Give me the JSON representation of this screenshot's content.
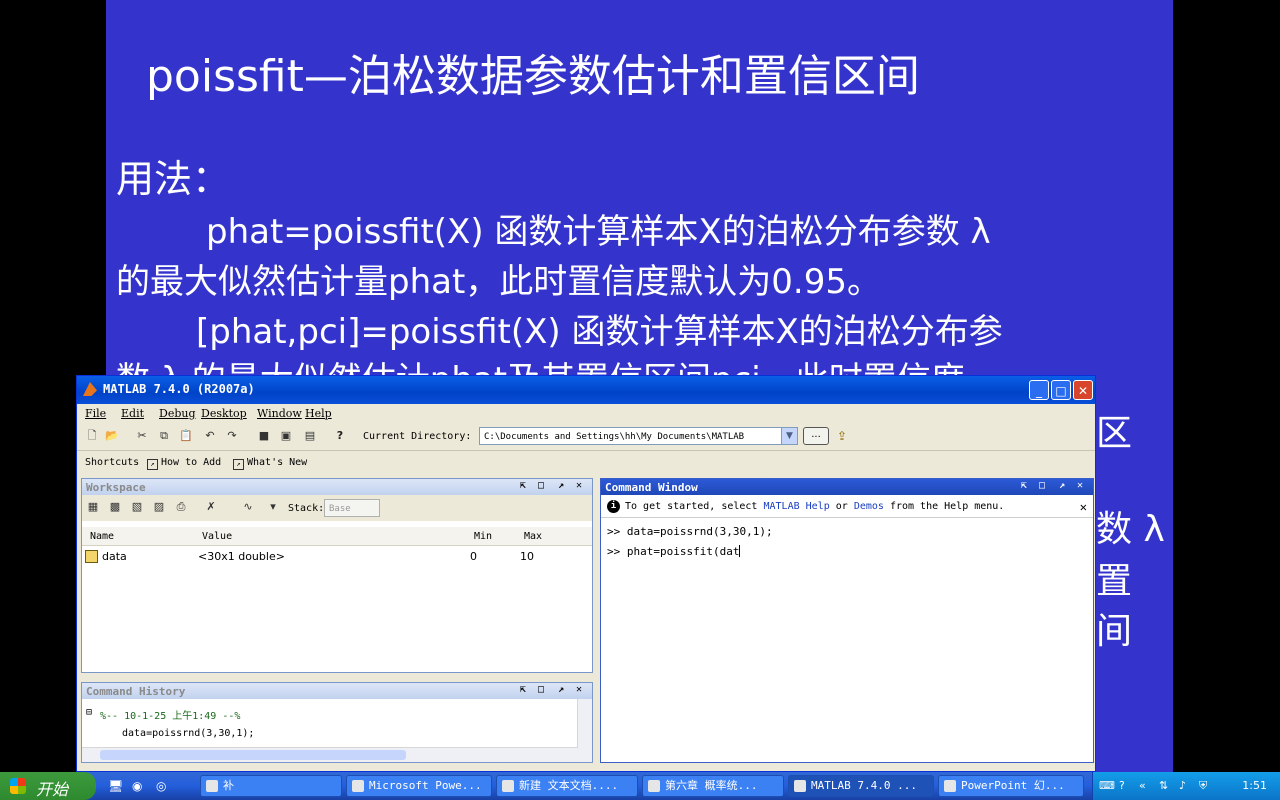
{
  "slide": {
    "title": "poissfit—泊松数据参数估计和置信区间",
    "usage": "用法：",
    "line1": "phat=poissfit(X)  函数计算样本X的泊松分布参数 λ",
    "line2": "的最大似然估计量phat，此时置信度默认为0.95。",
    "line3": "[phat,pci]=poissfit(X)  函数计算样本X的泊松分布参",
    "line4": "数 λ 的最大似然估计phat及其置信区间pci，此时置信度",
    "right_fragments": [
      "区",
      "数 λ",
      "置",
      "间"
    ]
  },
  "matlab": {
    "title": "MATLAB  7.4.0 (R2007a)",
    "menu": [
      "File",
      "Edit",
      "Debug",
      "Desktop",
      "Window",
      "Help"
    ],
    "current_directory_label": "Current Directory:",
    "current_directory": "C:\\Documents and Settings\\hh\\My Documents\\MATLAB",
    "browse_label": "...",
    "shortcuts": {
      "label": "Shortcuts",
      "how_to_add": "How to Add",
      "whats_new": "What's New"
    },
    "workspace": {
      "title": "Workspace",
      "stack_label": "Stack:",
      "stack_value": "Base",
      "columns": [
        "Name",
        "Value",
        "Min",
        "Max"
      ],
      "rows": [
        {
          "name": "data",
          "value": "<30x1 double>",
          "min": "0",
          "max": "10"
        }
      ]
    },
    "history": {
      "title": "Command History",
      "session": "%-- 10-1-25 上午1:49 --%",
      "entries": [
        "data=poissrnd(3,30,1);"
      ]
    },
    "command_window": {
      "title": "Command Window",
      "info_prefix": "To get started, select ",
      "info_link1": "MATLAB Help",
      "info_mid": " or ",
      "info_link2": "Demos",
      "info_suffix": " from the Help menu.",
      "lines": [
        ">> data=poissrnd(3,30,1);",
        ">> phat=poissfit(dat"
      ]
    }
  },
  "taskbar": {
    "start": "开始",
    "tasks": [
      "补",
      "Microsoft Powe...",
      "新建 文本文档....",
      "第六章 概率统...",
      "MATLAB  7.4.0 ...",
      "PowerPoint 幻..."
    ],
    "clock": "1:51"
  }
}
